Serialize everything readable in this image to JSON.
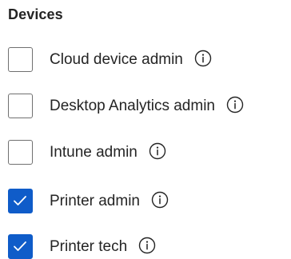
{
  "section": {
    "title": "Devices"
  },
  "roles": [
    {
      "label": "Cloud device admin",
      "checked": false,
      "info_icon": "info-icon"
    },
    {
      "label": "Desktop Analytics admin",
      "checked": false,
      "info_icon": "info-icon"
    },
    {
      "label": "Intune admin",
      "checked": false,
      "info_icon": "info-icon"
    },
    {
      "label": "Printer admin",
      "checked": true,
      "info_icon": "info-icon"
    },
    {
      "label": "Printer tech",
      "checked": true,
      "info_icon": "info-icon"
    }
  ],
  "colors": {
    "checkbox_checked": "#0f5cc9",
    "checkbox_border": "#707070",
    "text": "#242424"
  }
}
